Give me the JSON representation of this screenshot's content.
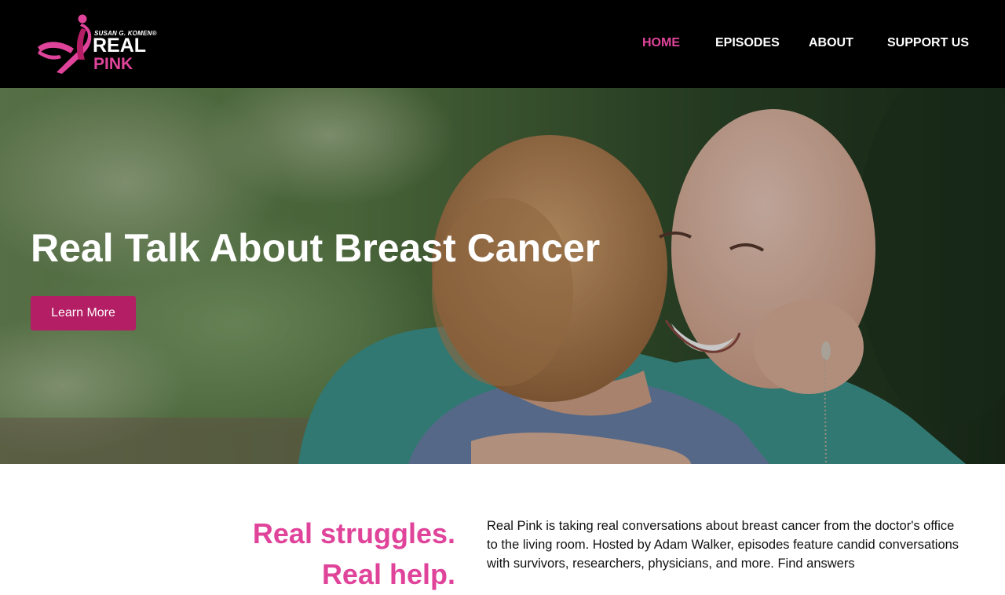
{
  "brand": {
    "tagline": "SUSAN G. KOMEN®",
    "name_line1": "REAL",
    "name_line2": "PINK",
    "accent_color": "#e0449a",
    "button_color": "#b31e64",
    "logo_icon": "pink-ribbon-icon"
  },
  "nav": {
    "items": [
      {
        "label": "HOME",
        "active": true
      },
      {
        "label": "EPISODES",
        "active": false
      },
      {
        "label": "ABOUT",
        "active": false
      },
      {
        "label": "SUPPORT US",
        "active": false
      }
    ]
  },
  "hero": {
    "title": "Real Talk About Breast Cancer",
    "button_label": "Learn More"
  },
  "intro": {
    "heading_line1": "Real struggles.",
    "heading_line2": "Real help.",
    "body": "Real Pink is taking real conversations about breast cancer from the doctor's office to the living room. Hosted by Adam Walker, episodes feature candid conversations with survivors, researchers, physicians, and more. Find answers"
  }
}
